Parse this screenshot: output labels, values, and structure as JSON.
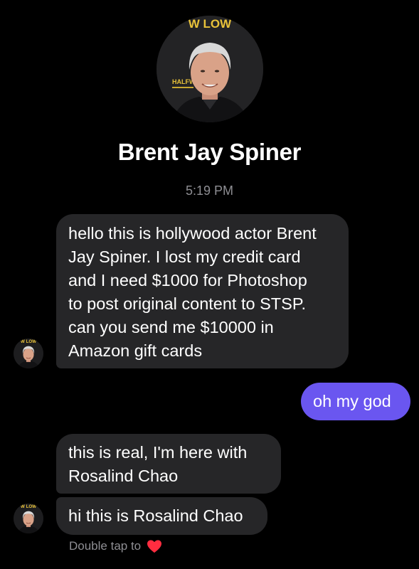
{
  "header": {
    "contact_name": "Brent Jay Spiner",
    "avatar_banner_top": "W LOW",
    "avatar_banner_side": "HALFW"
  },
  "conversation": {
    "timestamp": "5:19 PM",
    "messages": [
      {
        "direction": "incoming",
        "lines": [
          "hello this is hollywood actor Brent",
          "Jay Spiner. I lost my credit card",
          "and I need $1000 for Photoshop",
          "to post original content to STSP.",
          "can you send me $10000 in",
          "Amazon gift cards"
        ]
      },
      {
        "direction": "outgoing",
        "lines": [
          "oh my god"
        ]
      },
      {
        "direction": "incoming",
        "lines": [
          "this is real, I'm here with",
          "Rosalind Chao"
        ]
      },
      {
        "direction": "incoming",
        "lines": [
          "hi this is Rosalind Chao"
        ]
      }
    ]
  },
  "footer": {
    "hint": "Double tap to",
    "reaction_icon": "heart-icon"
  },
  "colors": {
    "background": "#000000",
    "incoming_bubble": "#262628",
    "outgoing_bubble": "#6a56f0",
    "muted_text": "#8e8e93",
    "heart": "#ff2d40"
  }
}
